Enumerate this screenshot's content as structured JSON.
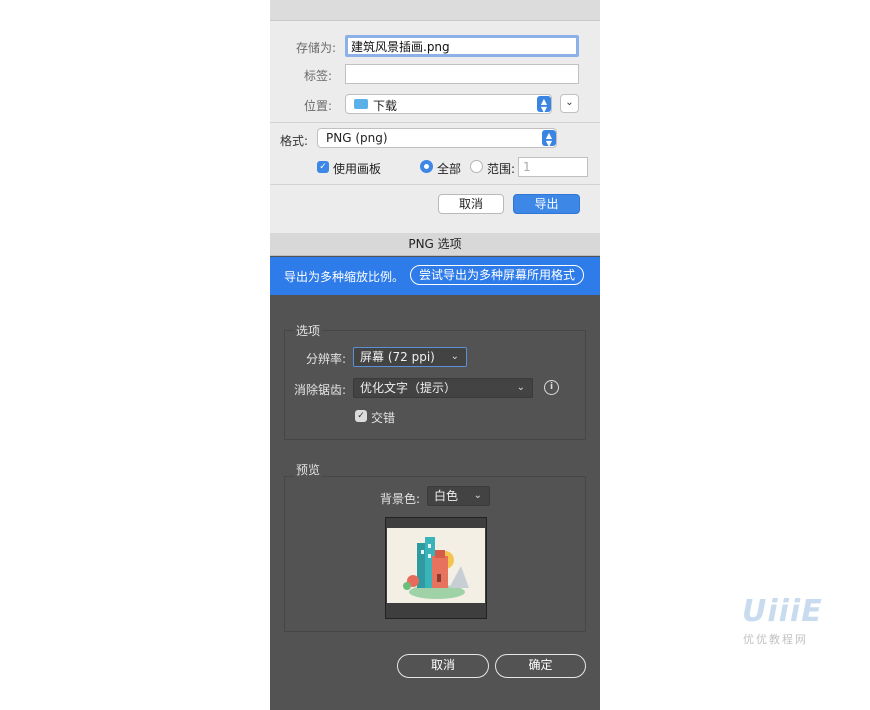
{
  "save_dialog": {
    "save_as_label": "存储为:",
    "filename": "建筑风景插画.png",
    "tags_label": "标签:",
    "tags_value": "",
    "location_label": "位置:",
    "location_value": "下载",
    "format_label": "格式:",
    "format_value": "PNG (png)",
    "use_artboards_label": "使用画板",
    "use_artboards_checked": true,
    "all_label": "全部",
    "range_label": "范围:",
    "range_value": "1",
    "cancel_label": "取消",
    "export_label": "导出"
  },
  "png_options": {
    "title": "PNG 选项",
    "banner_text": "导出为多种缩放比例。",
    "banner_button": "尝试导出为多种屏幕所用格式",
    "options_group_label": "选项",
    "resolution_label": "分辨率:",
    "resolution_value": "屏幕 (72 ppi)",
    "antialias_label": "消除锯齿:",
    "antialias_value": "优化文字（提示）",
    "interlace_label": "交错",
    "interlace_checked": true,
    "preview_group_label": "预览",
    "background_label": "背景色:",
    "background_value": "白色",
    "cancel_label": "取消",
    "ok_label": "确定"
  },
  "watermark": {
    "logo": "UiiiE",
    "text": "优优教程网"
  },
  "colors": {
    "accent_blue": "#3d87e6",
    "banner_blue": "#2e7bea",
    "dark_panel": "#535353",
    "light_panel": "#ececec"
  }
}
